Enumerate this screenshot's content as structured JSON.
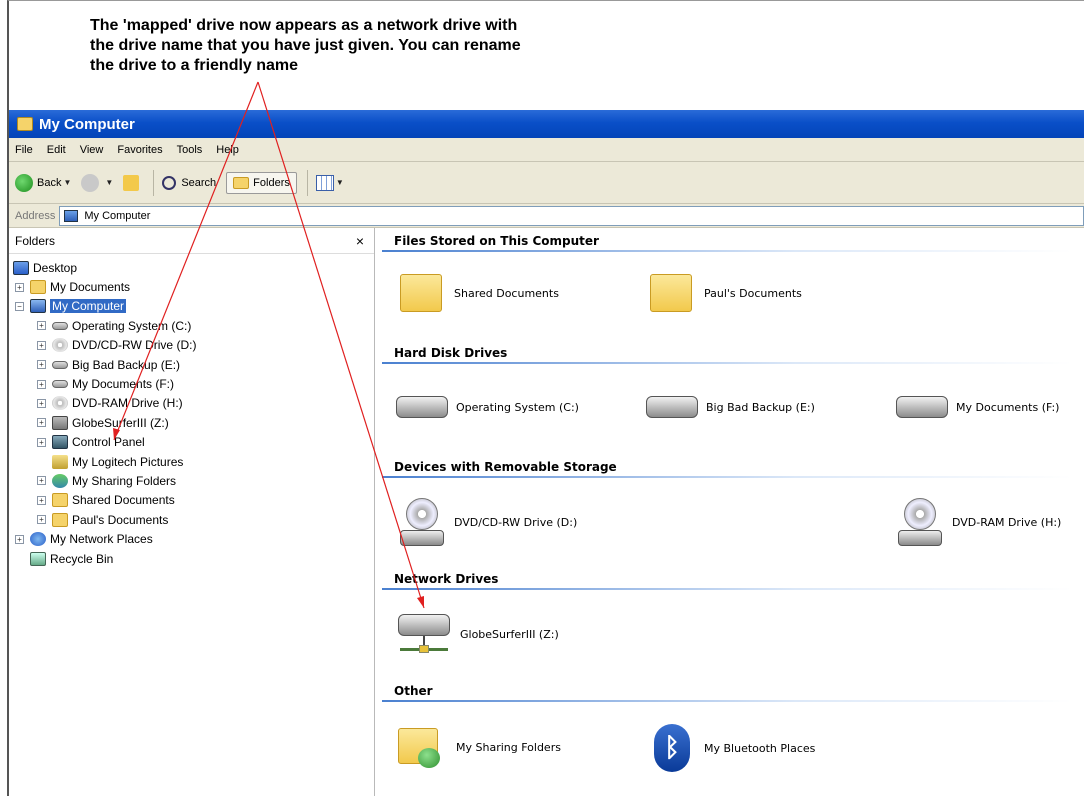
{
  "annotation": {
    "line1": "The 'mapped' drive now appears as a network drive with",
    "line2": "the drive name that you have just given. You can rename",
    "line3": "the drive to a friendly name"
  },
  "window": {
    "title": "My Computer"
  },
  "menu": {
    "items": [
      "File",
      "Edit",
      "View",
      "Favorites",
      "Tools",
      "Help"
    ]
  },
  "toolbar": {
    "back": "Back",
    "search": "Search",
    "folders": "Folders"
  },
  "address": {
    "label": "Address",
    "value": "My Computer"
  },
  "folders_pane": {
    "title": "Folders",
    "close": "×",
    "tree": [
      {
        "label": "Desktop"
      },
      {
        "label": "My Documents"
      },
      {
        "label": "My Computer"
      },
      {
        "label": "Operating System (C:)"
      },
      {
        "label": "DVD/CD-RW Drive (D:)"
      },
      {
        "label": "Big Bad Backup (E:)"
      },
      {
        "label": "My Documents (F:)"
      },
      {
        "label": "DVD-RAM Drive (H:)"
      },
      {
        "label": "GlobeSurferIII (Z:)"
      },
      {
        "label": "Control Panel"
      },
      {
        "label": "My Logitech Pictures"
      },
      {
        "label": "My Sharing Folders"
      },
      {
        "label": "Shared Documents"
      },
      {
        "label": "Paul's Documents"
      },
      {
        "label": "My Network Places"
      },
      {
        "label": "Recycle Bin"
      }
    ]
  },
  "content": {
    "groups": [
      {
        "title": "Files Stored on This Computer",
        "items": [
          "Shared Documents",
          "Paul's Documents"
        ]
      },
      {
        "title": "Hard Disk Drives",
        "items": [
          "Operating System (C:)",
          "Big Bad Backup (E:)",
          "My Documents (F:)"
        ]
      },
      {
        "title": "Devices with Removable Storage",
        "items": [
          "DVD/CD-RW Drive (D:)",
          "DVD-RAM Drive (H:)"
        ]
      },
      {
        "title": "Network Drives",
        "items": [
          "GlobeSurferIII (Z:)"
        ]
      },
      {
        "title": "Other",
        "items": [
          "My Sharing Folders",
          "My Bluetooth Places"
        ]
      }
    ]
  },
  "colors": {
    "titlebar": "#0a4fc8",
    "selection": "#316ac5",
    "arrow": "#e02020",
    "chrome": "#ece9d8"
  }
}
